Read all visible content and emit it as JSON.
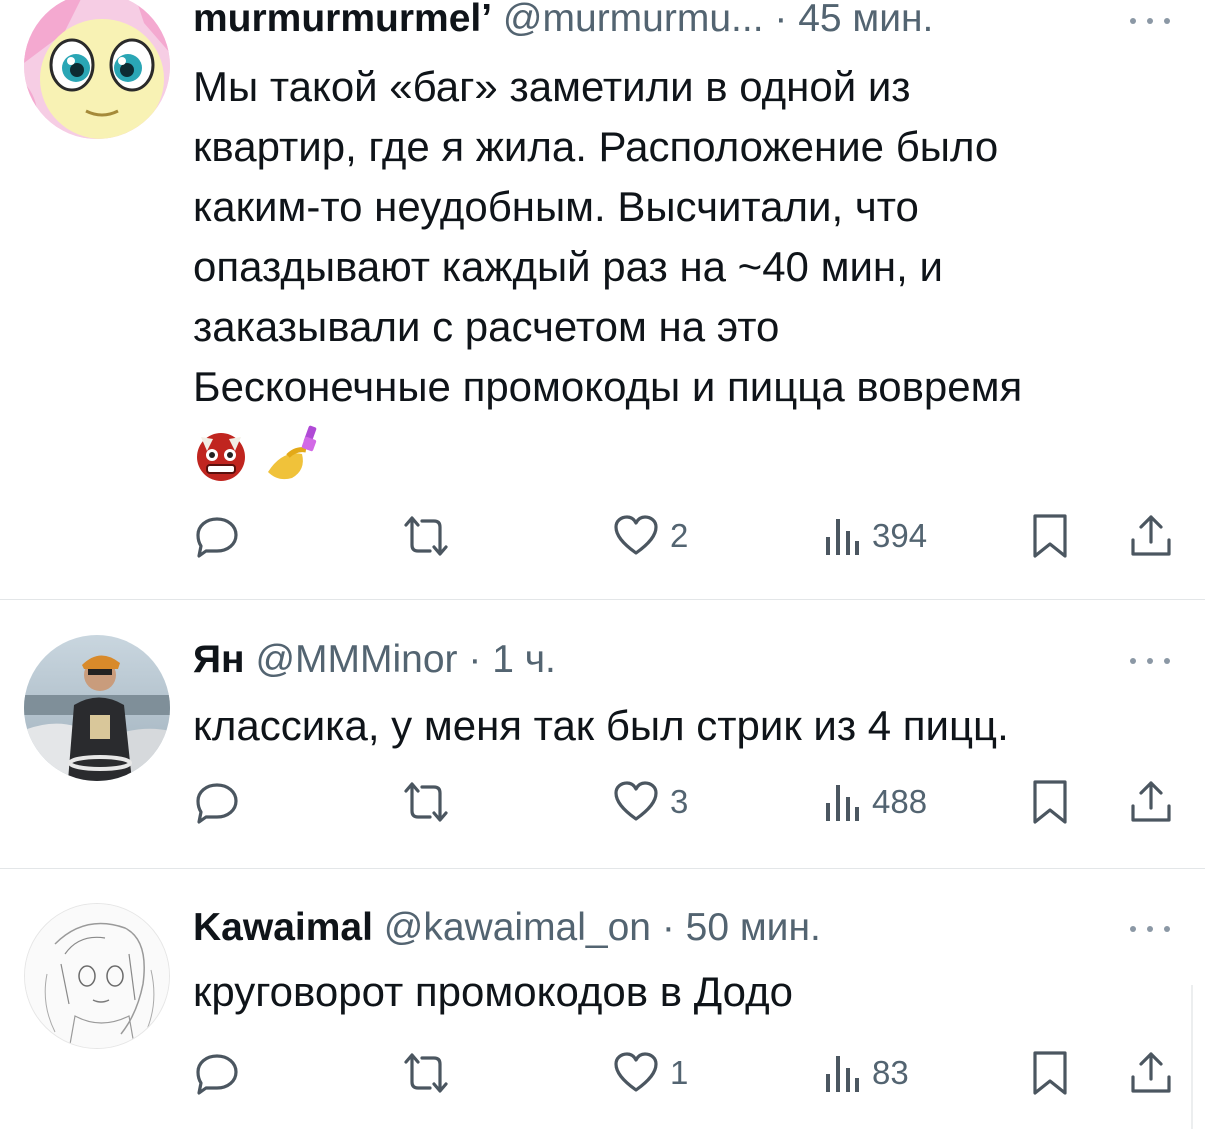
{
  "tweets": [
    {
      "name": "murmurmurmel’",
      "handle": "@murmurmu...",
      "sep": " · ",
      "time": "45 мин.",
      "lines": [
        "Мы такой «баг» заметили в одной из",
        "квартир, где я жила. Расположение было",
        "каким-то неудобным. Высчитали, что",
        "опаздывают каждый раз на ~40 мин, и",
        "заказывали с расчетом на это",
        "Бесконечные промокоды и пицца вовремя"
      ],
      "emojis": [
        "ogre",
        "nail-polish"
      ],
      "likes": "2",
      "views": "394"
    },
    {
      "name": "Ян",
      "handle": "@MMMinor",
      "sep": " · ",
      "time": "1 ч.",
      "lines": [
        "классика, у меня так был стрик из 4 пицц."
      ],
      "likes": "3",
      "views": "488"
    },
    {
      "name": "Kawaimal",
      "handle": "@kawaimal_on",
      "sep": " · ",
      "time": "50 мин.",
      "lines": [
        "круговорот промокодов в Додо"
      ],
      "likes": "1",
      "views": "83"
    }
  ],
  "colors": {
    "text": "#0f1419",
    "muted": "#536471",
    "divider": "#e3e6e8"
  },
  "icons": [
    "reply-icon",
    "retweet-icon",
    "like-icon",
    "views-icon",
    "bookmark-icon",
    "share-icon",
    "more-icon"
  ]
}
